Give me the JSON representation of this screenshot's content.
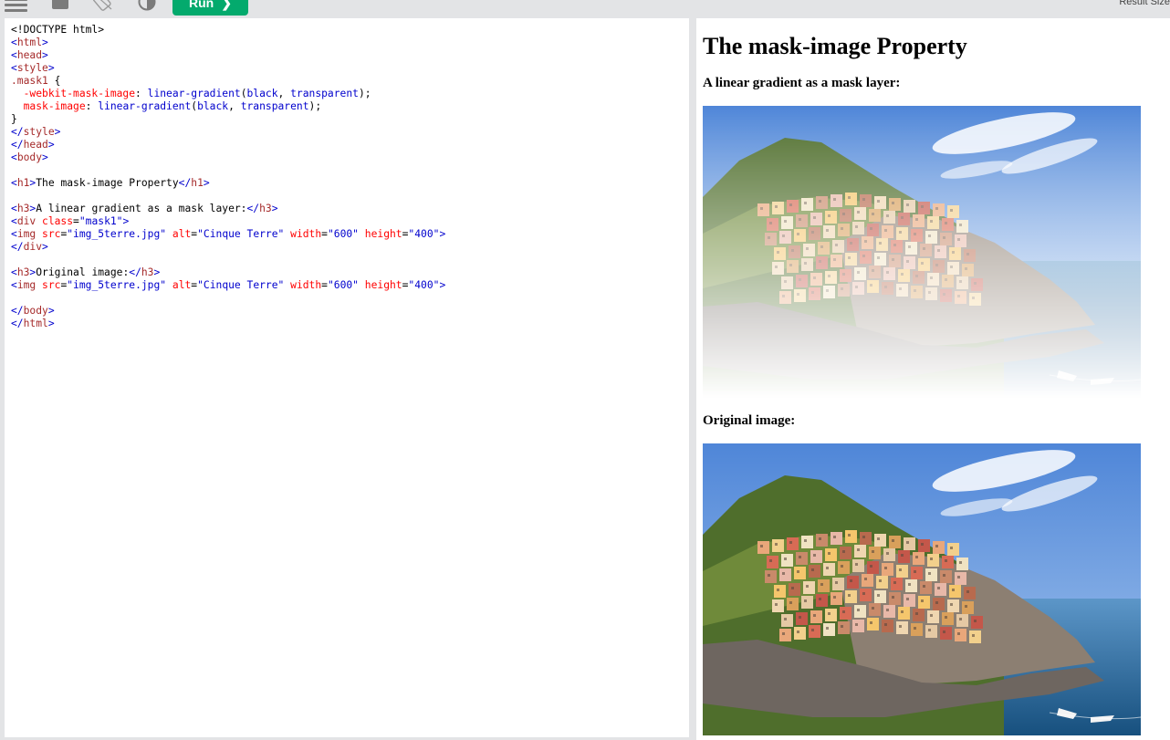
{
  "toolbar": {
    "icons": [
      "menu-icon",
      "save-icon",
      "rotate-icon",
      "contrast-icon"
    ],
    "run_label": "Run",
    "run_chevron": "❯",
    "result_size_label": "Result Size",
    "run_color": "#04aa6d"
  },
  "editor": {
    "lines": [
      "<!DOCTYPE html>",
      "<html>",
      "<head>",
      "<style>",
      ".mask1 {",
      "  -webkit-mask-image: linear-gradient(black, transparent);",
      "  mask-image: linear-gradient(black, transparent);",
      "}",
      "</style>",
      "</head>",
      "<body>",
      "",
      "<h1>The mask-image Property</h1>",
      "",
      "<h3>A linear gradient as a mask layer:</h3>",
      "<div class=\"mask1\">",
      "<img src=\"img_5terre.jpg\" alt=\"Cinque Terre\" width=\"600\" height=\"400\">",
      "</div>",
      "",
      "<h3>Original image:</h3>",
      "<img src=\"img_5terre.jpg\" alt=\"Cinque Terre\" width=\"600\" height=\"400\">",
      "",
      "</body>",
      "</html>"
    ]
  },
  "result": {
    "title": "The mask-image Property",
    "subtitle_mask": "A linear gradient as a mask layer:",
    "subtitle_original": "Original image:",
    "image_alt": "Cinque Terre"
  }
}
